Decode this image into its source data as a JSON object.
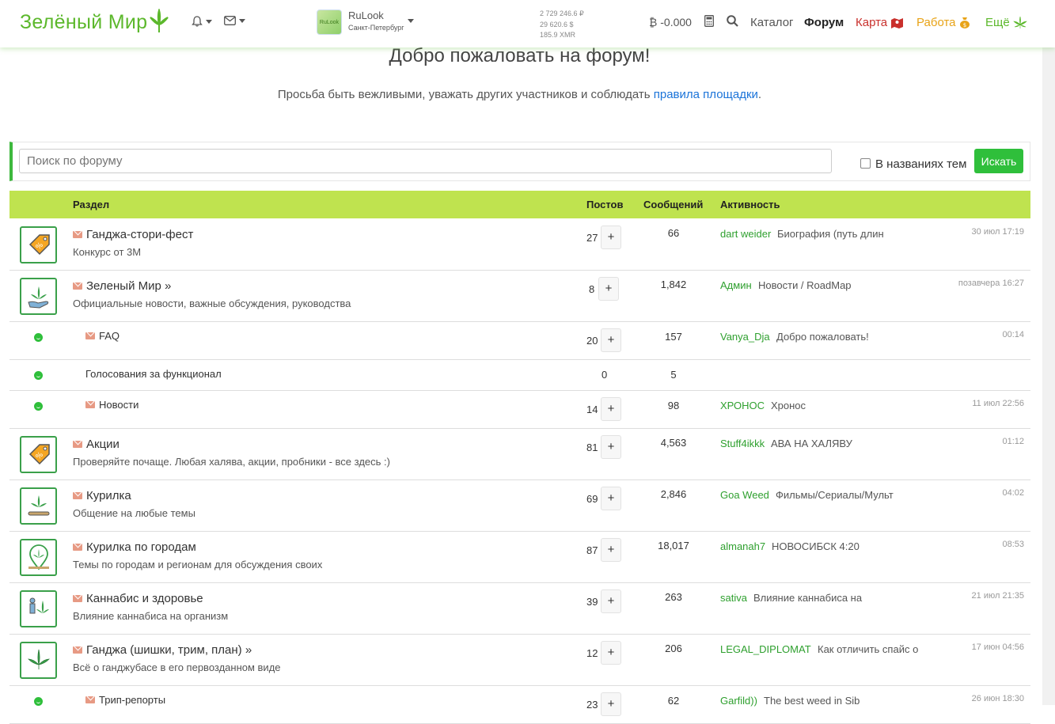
{
  "header": {
    "logo_text": "Зелёный Мир",
    "city": {
      "name": "RuLook",
      "region": "Санкт-Петербург",
      "thumb_text": "RuLook"
    },
    "rates": [
      "2 729 246.6 ₽",
      "29 620.6 $",
      "185.9 XMR"
    ],
    "balance": "₿ -0.000",
    "nav": {
      "catalog": "Каталог",
      "forum": "Форум",
      "map": "Карта",
      "job": "Работа",
      "more": "Ещё"
    },
    "colors": {
      "brand": "#5cb82c",
      "map": "#c9302c",
      "job": "#e8a317"
    }
  },
  "main": {
    "welcome": "Добро пожаловать на форум!",
    "notice_text": "Просьба быть вежливыми, уважать других участников и соблюдать ",
    "notice_link": "правила площадки",
    "notice_end": "."
  },
  "search": {
    "placeholder": "Поиск по форуму",
    "checkbox_label": "В названиях тем",
    "button": "Искать"
  },
  "table": {
    "headers": {
      "section": "Раздел",
      "posts": "Постов",
      "messages": "Сообщений",
      "activity": "Активность"
    },
    "rows": [
      {
        "icon": "coupon-icon",
        "title": "Ганджа-стори-фест",
        "desc": "Конкурс от 3М",
        "posts": "27",
        "plus": "+",
        "messages": "66",
        "user": "dart weider",
        "topic": "Биография (путь длин",
        "time": "30 июл 17:19"
      },
      {
        "icon": "hand-leaf-icon",
        "title": "Зеленый Мир »",
        "desc": "Официальные новости, важные обсуждения, руководства",
        "posts": "8",
        "plus": "+",
        "messages": "1,842",
        "user": "Админ",
        "topic": "Новости / RoadMap",
        "time": "позавчера 16:27"
      },
      {
        "icon": "smile-icon",
        "title": "FAQ",
        "desc": "",
        "posts": "20",
        "plus": "+",
        "messages": "157",
        "user": "Vanya_Dja",
        "topic": "Добро пожаловать!",
        "time": "00:14"
      },
      {
        "icon": "smile-icon",
        "title": "Голосования за функционал",
        "desc": "",
        "posts": "0",
        "plus": "",
        "messages": "5",
        "user": "",
        "topic": "",
        "time": ""
      },
      {
        "icon": "smile-icon",
        "title": "Новости",
        "desc": "",
        "posts": "14",
        "plus": "+",
        "messages": "98",
        "user": "ХРОНОС",
        "topic": "Хронос",
        "time": "11 июл 22:56"
      },
      {
        "icon": "coupon-icon",
        "title": "Акции",
        "desc": "Проверяйте почаще. Любая халява, акции, пробники - все здесь :)",
        "posts": "81",
        "plus": "+",
        "messages": "4,563",
        "user": "Stuff4ikkk",
        "topic": "АВА НА ХАЛЯВУ",
        "time": "01:12"
      },
      {
        "icon": "joint-icon",
        "title": "Курилка",
        "desc": "Общение на любые темы",
        "posts": "69",
        "plus": "+",
        "messages": "2,846",
        "user": "Goa Weed",
        "topic": "Фильмы/Сериалы/Мульт",
        "time": "04:02"
      },
      {
        "icon": "map-pin-leaf-icon",
        "title": "Курилка по городам",
        "desc": "Темы по городам и регионам для обсуждения своих",
        "posts": "87",
        "plus": "+",
        "messages": "18,017",
        "user": "almanah7",
        "topic": "НОВОСИБСК 4:20",
        "time": "08:53"
      },
      {
        "icon": "person-leaf-icon",
        "title": "Каннабис и здоровье",
        "desc": "Влияние каннабиса на организм",
        "posts": "39",
        "plus": "+",
        "messages": "263",
        "user": "sativa",
        "topic": "Влияние каннабиса на",
        "time": "21 июл 21:35"
      },
      {
        "icon": "leaf-icon",
        "title": "Ганджа (шишки, трим, план) »",
        "desc": "Всё о ганджубасе в его первозданном виде",
        "posts": "12",
        "plus": "+",
        "messages": "206",
        "user": "LEGAL_DIPLOMAT",
        "topic": "Как отличить спайс о",
        "time": "17 июн 04:56"
      },
      {
        "icon": "smile-icon",
        "title": "Трип-репорты",
        "desc": "",
        "posts": "23",
        "plus": "+",
        "messages": "62",
        "user": "Garfild))",
        "topic": "The best weed in Sib",
        "time": "26 июн 18:30"
      }
    ]
  }
}
